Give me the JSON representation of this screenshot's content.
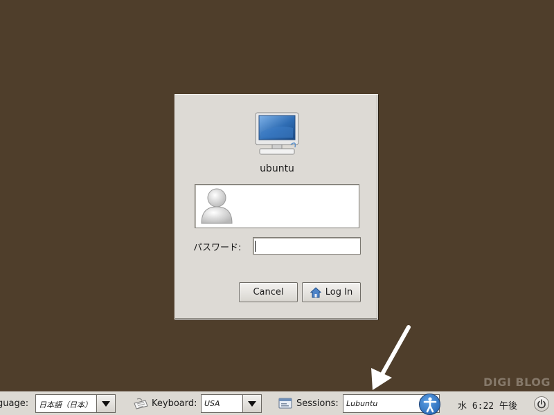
{
  "dialog": {
    "hostname": "ubuntu",
    "user_name": "",
    "password_label": "パスワード:",
    "password_value": "",
    "cancel_label": "Cancel",
    "login_label": "Log In"
  },
  "panel": {
    "language_label": "guage:",
    "language_value": "日本語（日本）",
    "keyboard_label": "Keyboard:",
    "keyboard_value": "USA",
    "sessions_label": "Sessions:",
    "sessions_value": "Lubuntu",
    "clock": "水  6:22 午後"
  },
  "watermark": "DIGI BLOG",
  "icons": {
    "host": "computer-icon",
    "user": "user-avatar-icon",
    "login": "home-icon",
    "keyboard": "keyboard-icon",
    "sessions": "session-icon",
    "accessibility": "accessibility-icon",
    "power": "power-icon"
  },
  "colors": {
    "desktop": "#4f3e2b",
    "dialog": "#dddad5",
    "panel": "#dcd9d3",
    "accent": "#1f5fae"
  }
}
